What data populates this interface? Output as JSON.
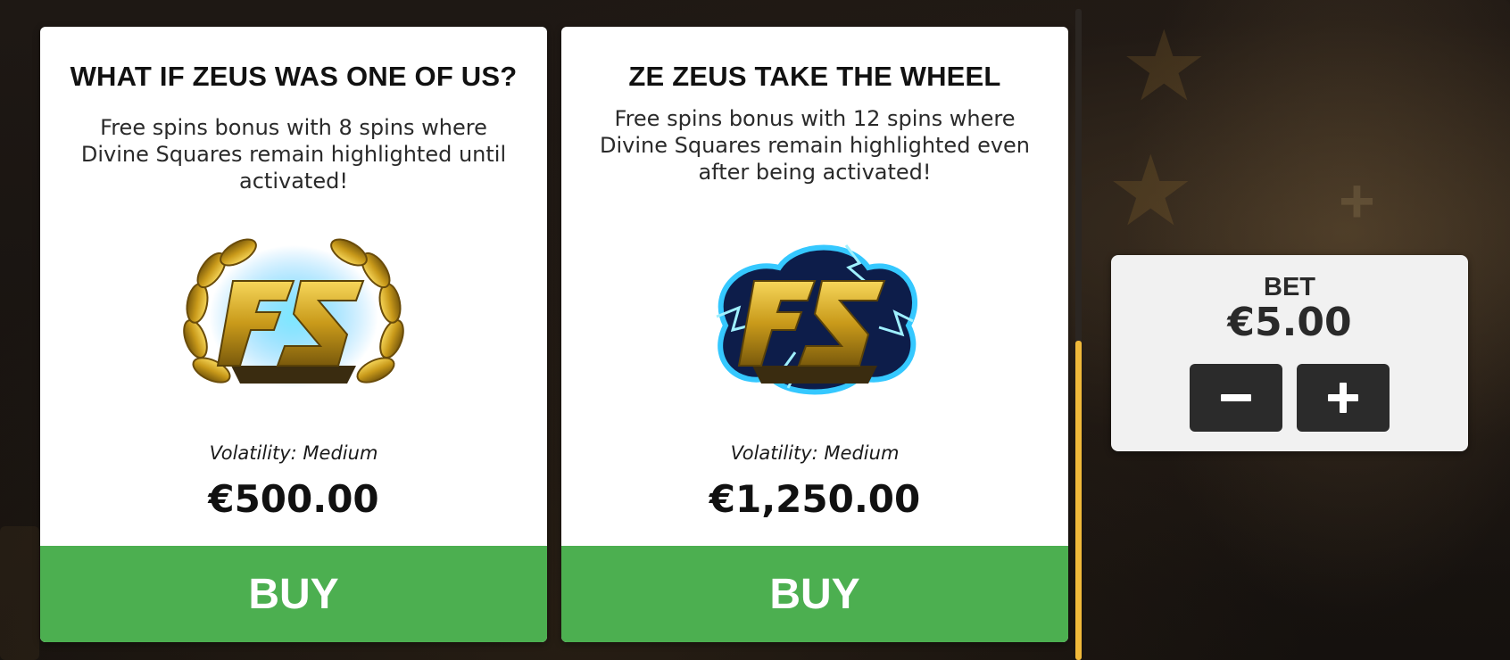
{
  "offers": [
    {
      "title": "WHAT IF ZEUS WAS ONE OF US?",
      "description": "Free spins bonus with 8 spins where Divine Squares remain highlighted until activated!",
      "icon": "fs-laurel-icon",
      "volatility": "Volatility: Medium",
      "price": "€500.00",
      "buy_label": "BUY"
    },
    {
      "title": "ZE ZEUS TAKE THE WHEEL",
      "description": "Free spins bonus with 12 spins where Divine Squares remain highlighted even after being activated!",
      "icon": "fs-lightning-icon",
      "volatility": "Volatility: Medium",
      "price": "€1,250.00",
      "buy_label": "BUY"
    }
  ],
  "bet": {
    "label": "BET",
    "value": "€5.00",
    "decrease_icon": "minus-icon",
    "increase_icon": "plus-icon"
  },
  "colors": {
    "buy_button": "#4caf50",
    "scroll_thumb": "#f0b93a",
    "stepper_button": "#2b2b2b",
    "panel_background": "#f1f1f1"
  }
}
